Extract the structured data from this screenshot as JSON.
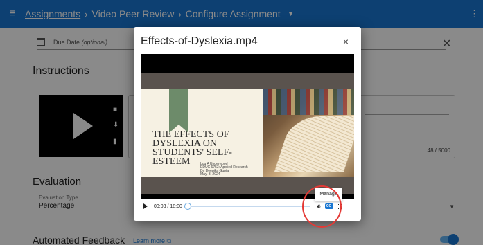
{
  "appbar": {
    "breadcrumb": [
      "Assignments",
      "Video Peer Review",
      "Configure Assignment"
    ],
    "separator": "›"
  },
  "form": {
    "due_date": "Due Date",
    "due_date_hint": "(optional)",
    "instructions_heading": "Instructions",
    "char_counter": "48 / 5000",
    "evaluation_heading": "Evaluation",
    "evaluation_type_label": "Evaluation Type",
    "evaluation_type_value": "Percentage",
    "automated_feedback_heading": "Automated Feedback",
    "learn_more": "Learn more"
  },
  "dialog": {
    "title": "Effects-of-Dyslexia.mp4",
    "close": "×",
    "slide": {
      "title": "THE EFFECTS OF DYSLEXIA ON STUDENTS' SELF-ESTEEM",
      "author": "Lou A Underwood",
      "course": "EDUC 6753: Applied Research",
      "instructor": "Dr. Deepika Gupta",
      "date": "May. 3, 2024"
    },
    "player": {
      "time": "00:03 / 18:00",
      "progress": 0.003,
      "cc_label": "CC"
    },
    "tooltip": "Manage"
  },
  "colors": {
    "appbar": "#1976d2",
    "annotation_circle": "#e53935"
  }
}
